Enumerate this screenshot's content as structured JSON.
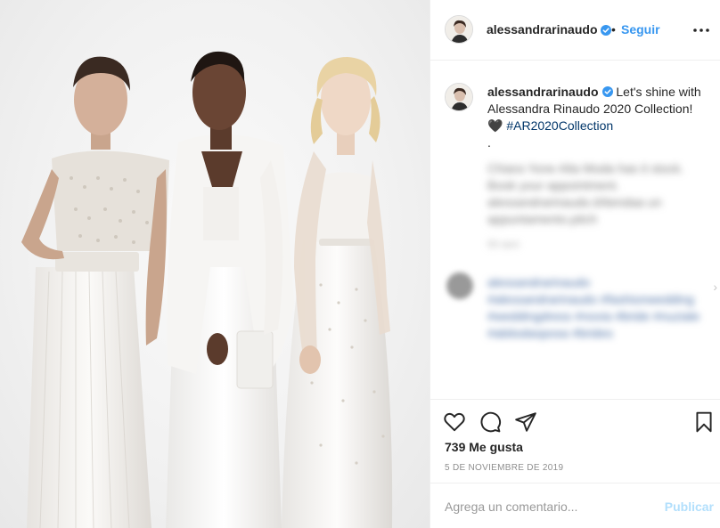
{
  "post": {
    "username": "alessandrarinaudo",
    "verified": true,
    "separator": "•",
    "follow_label": "Seguir",
    "caption_line": "Let's shine with Alessandra Rinaudo 2020 Collection!",
    "caption_emoji": "🖤",
    "hashtag": "#AR2020Collection",
    "caption_dot": ".",
    "likes": "739 Me gusta",
    "date": "5 DE NOVIEMBRE DE 2019"
  },
  "blurred_comments": [
    "Chiara Yone Alta Moda has it stock. Book your appointment. alessandrarinaudo.it/tiendaa un appuntamento.pitch",
    "alessandrarinaudo #alessandrarinaudo #fashionwedding #weddingdress #novia #bride #nuziale #abitodasposa #brides"
  ],
  "actions": {
    "like_icon": "heart-icon",
    "comment_icon": "comment-icon",
    "share_icon": "share-icon",
    "save_icon": "bookmark-icon"
  },
  "comment": {
    "placeholder": "Agrega un comentario...",
    "publish_label": "Publicar"
  },
  "colors": {
    "accent": "#3897f0",
    "hashtag": "#003569",
    "publish_disabled": "#b2dffc",
    "muted": "#8e8e8e",
    "divider": "#efefef"
  }
}
